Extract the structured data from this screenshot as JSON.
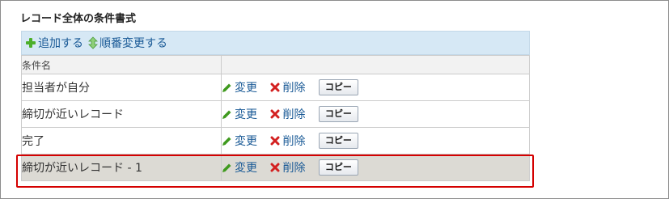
{
  "section": {
    "title": "レコード全体の条件書式"
  },
  "toolbar": {
    "add_label": "追加する",
    "reorder_label": "順番変更する"
  },
  "table": {
    "header_name": "条件名",
    "header_actions": "",
    "rows": [
      {
        "name": "担当者が自分",
        "edit": "変更",
        "delete": "削除",
        "copy": "コピー"
      },
      {
        "name": "締切が近いレコード",
        "edit": "変更",
        "delete": "削除",
        "copy": "コピー"
      },
      {
        "name": "完了",
        "edit": "変更",
        "delete": "削除",
        "copy": "コピー"
      },
      {
        "name": "締切が近いレコード - 1",
        "edit": "変更",
        "delete": "削除",
        "copy": "コピー"
      }
    ]
  },
  "highlighted_row": 3,
  "colors": {
    "link": "#1a5a96",
    "toolbar_bg": "#d6e8f5",
    "highlight_row_bg": "#dcdad4",
    "highlight_border": "#d40000",
    "add_icon": "#4caf2a",
    "delete_icon": "#d32020",
    "edit_icon": "#3f9a1e"
  },
  "icons": {
    "add": "plus-icon",
    "reorder": "up-down-arrow-icon",
    "edit": "pencil-icon",
    "delete": "x-icon"
  }
}
